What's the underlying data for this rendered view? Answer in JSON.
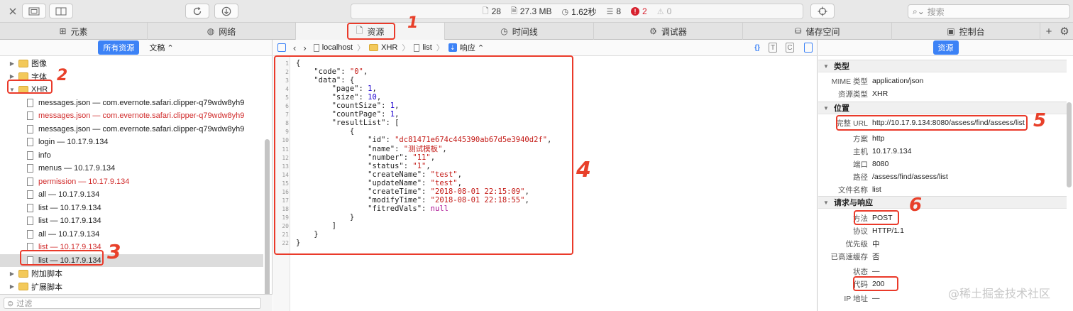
{
  "toolbar": {
    "stats": {
      "requests": "28",
      "size": "27.3 MB",
      "time": "1.62秒",
      "logs": "8",
      "errors": "2",
      "warnings": "0"
    },
    "search_placeholder": "搜索"
  },
  "tabs": [
    {
      "label": "元素",
      "icon": "elements-icon"
    },
    {
      "label": "网络",
      "icon": "network-icon"
    },
    {
      "label": "资源",
      "icon": "resources-icon",
      "active": true
    },
    {
      "label": "时间线",
      "icon": "timeline-icon"
    },
    {
      "label": "调试器",
      "icon": "debugger-icon"
    },
    {
      "label": "储存空间",
      "icon": "storage-icon"
    },
    {
      "label": "控制台",
      "icon": "console-icon"
    }
  ],
  "left": {
    "scope_all": "所有资源",
    "scope_doc": "文稿 ⌃",
    "rows": [
      {
        "kind": "folder",
        "label": "图像",
        "open": false
      },
      {
        "kind": "folder",
        "label": "字体",
        "open": false
      },
      {
        "kind": "folder",
        "label": "XHR",
        "open": true
      },
      {
        "kind": "file",
        "label": "messages.json — com.evernote.safari.clipper-q79wdw8yh9",
        "red": false
      },
      {
        "kind": "file",
        "label": "messages.json — com.evernote.safari.clipper-q79wdw8yh9",
        "red": true
      },
      {
        "kind": "file",
        "label": "messages.json — com.evernote.safari.clipper-q79wdw8yh9",
        "red": false
      },
      {
        "kind": "file",
        "label": "login — 10.17.9.134",
        "red": false
      },
      {
        "kind": "file",
        "label": "info",
        "red": false
      },
      {
        "kind": "file",
        "label": "menus — 10.17.9.134",
        "red": false
      },
      {
        "kind": "file",
        "label": "permission — 10.17.9.134",
        "red": true
      },
      {
        "kind": "file",
        "label": "all — 10.17.9.134",
        "red": false
      },
      {
        "kind": "file",
        "label": "list — 10.17.9.134",
        "red": false
      },
      {
        "kind": "file",
        "label": "list — 10.17.9.134",
        "red": false
      },
      {
        "kind": "file",
        "label": "all — 10.17.9.134",
        "red": false
      },
      {
        "kind": "file",
        "label": "list — 10.17.9.134",
        "red": true
      },
      {
        "kind": "file",
        "label": "list — 10.17.9.134",
        "red": false,
        "selected": true
      },
      {
        "kind": "folder",
        "label": "附加脚本",
        "open": false
      },
      {
        "kind": "folder",
        "label": "扩展脚本",
        "open": false
      }
    ],
    "filter_placeholder": "过滤"
  },
  "center": {
    "crumbs": [
      "localhost",
      "XHR",
      "list",
      "响应 ⌃"
    ],
    "code_lines": [
      "{",
      "    \"code\": \"0\",",
      "    \"data\": {",
      "        \"page\": 1,",
      "        \"size\": 10,",
      "        \"countSize\": 1,",
      "        \"countPage\": 1,",
      "        \"resultList\": [",
      "            {",
      "                \"id\": \"dc81471e674c445390ab67d5e3940d2f\",",
      "                \"name\": \"测试模板\",",
      "                \"number\": \"11\",",
      "                \"status\": \"1\",",
      "                \"createName\": \"test\",",
      "                \"updateName\": \"test\",",
      "                \"createTime\": \"2018-08-01 22:15:09\",",
      "                \"modifyTime\": \"2018-08-01 22:18:55\",",
      "                \"fitredVals\": null",
      "            }",
      "        ]",
      "    }",
      "}"
    ]
  },
  "right": {
    "head_pill": "资源",
    "sections": [
      {
        "title": "类型",
        "rows": [
          {
            "k": "MIME 类型",
            "v": "application/json"
          },
          {
            "k": "资源类型",
            "v": "XHR"
          }
        ]
      },
      {
        "title": "位置",
        "rows": [
          {
            "k": "完整 URL",
            "v": "http://10.17.9.134:8080/assess/find/assess/list"
          },
          {
            "k": "方案",
            "v": "http"
          },
          {
            "k": "主机",
            "v": "10.17.9.134"
          },
          {
            "k": "端口",
            "v": "8080"
          },
          {
            "k": "路径",
            "v": "/assess/find/assess/list"
          },
          {
            "k": "文件名称",
            "v": "list"
          }
        ]
      },
      {
        "title": "请求与响应",
        "rows": [
          {
            "k": "方法",
            "v": "POST"
          },
          {
            "k": "协议",
            "v": "HTTP/1.1"
          },
          {
            "k": "优先级",
            "v": "中"
          },
          {
            "k": "已高速缓存",
            "v": "否"
          },
          {
            "k": "",
            "v": ""
          },
          {
            "k": "状态",
            "v": "—"
          },
          {
            "k": "代码",
            "v": "200"
          },
          {
            "k": "IP 地址",
            "v": "—"
          }
        ]
      }
    ]
  },
  "annotations": [
    "1",
    "2",
    "3",
    "4",
    "5",
    "6"
  ],
  "watermark": "@稀土掘金技术社区",
  "colors": {
    "annotation": "#ea3a2a",
    "accent": "#3c82f6",
    "error": "#d7202d"
  }
}
